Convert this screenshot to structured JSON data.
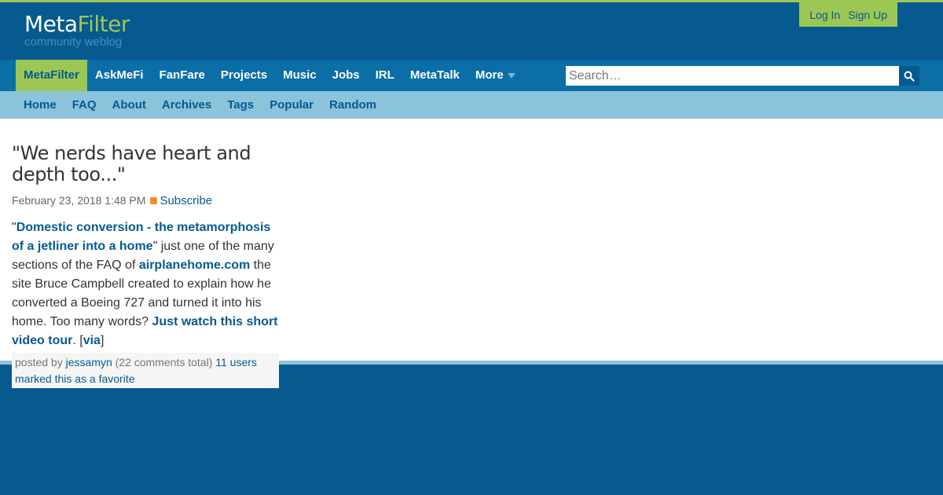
{
  "brand": {
    "logo_part1": "Meta",
    "logo_part2": "Filter",
    "tagline": "community weblog"
  },
  "auth": {
    "login": "Log In",
    "signup": "Sign Up"
  },
  "nav": {
    "items": [
      "MetaFilter",
      "AskMeFi",
      "FanFare",
      "Projects",
      "Music",
      "Jobs",
      "IRL",
      "MetaTalk",
      "More"
    ],
    "active_index": 0,
    "search_placeholder": "Search…"
  },
  "subnav": {
    "items": [
      "Home",
      "FAQ",
      "About",
      "Archives",
      "Tags",
      "Popular",
      "Random"
    ]
  },
  "post": {
    "title": "\"We nerds have heart and depth too...\"",
    "date": "February 23, 2018 1:48 PM",
    "subscribe": "Subscribe",
    "body": {
      "t1": "\"",
      "link1": "Domestic conversion - the metamorphosis of a jetliner into a home",
      "t2": "\" just one of the many sections of the FAQ of ",
      "link2": "airplanehome.com",
      "t3": " the site Bruce Campbell created to explain how he converted a Boeing 727 and turned it into his home. Too many words? ",
      "link3": "Just watch this short video tour",
      "t4": ". [",
      "link4": "via",
      "t5": "]"
    },
    "byline": {
      "posted_by": "posted by ",
      "user": "jessamyn",
      "comments": " (22 comments total) ",
      "favorites": "11 users marked this as a favorite"
    }
  },
  "colors": {
    "header_bg": "#065a8f",
    "nav_bg": "#0b6ea6",
    "accent_green": "#9cc754",
    "subnav_bg": "#8ac3da",
    "link": "#065a8f"
  }
}
